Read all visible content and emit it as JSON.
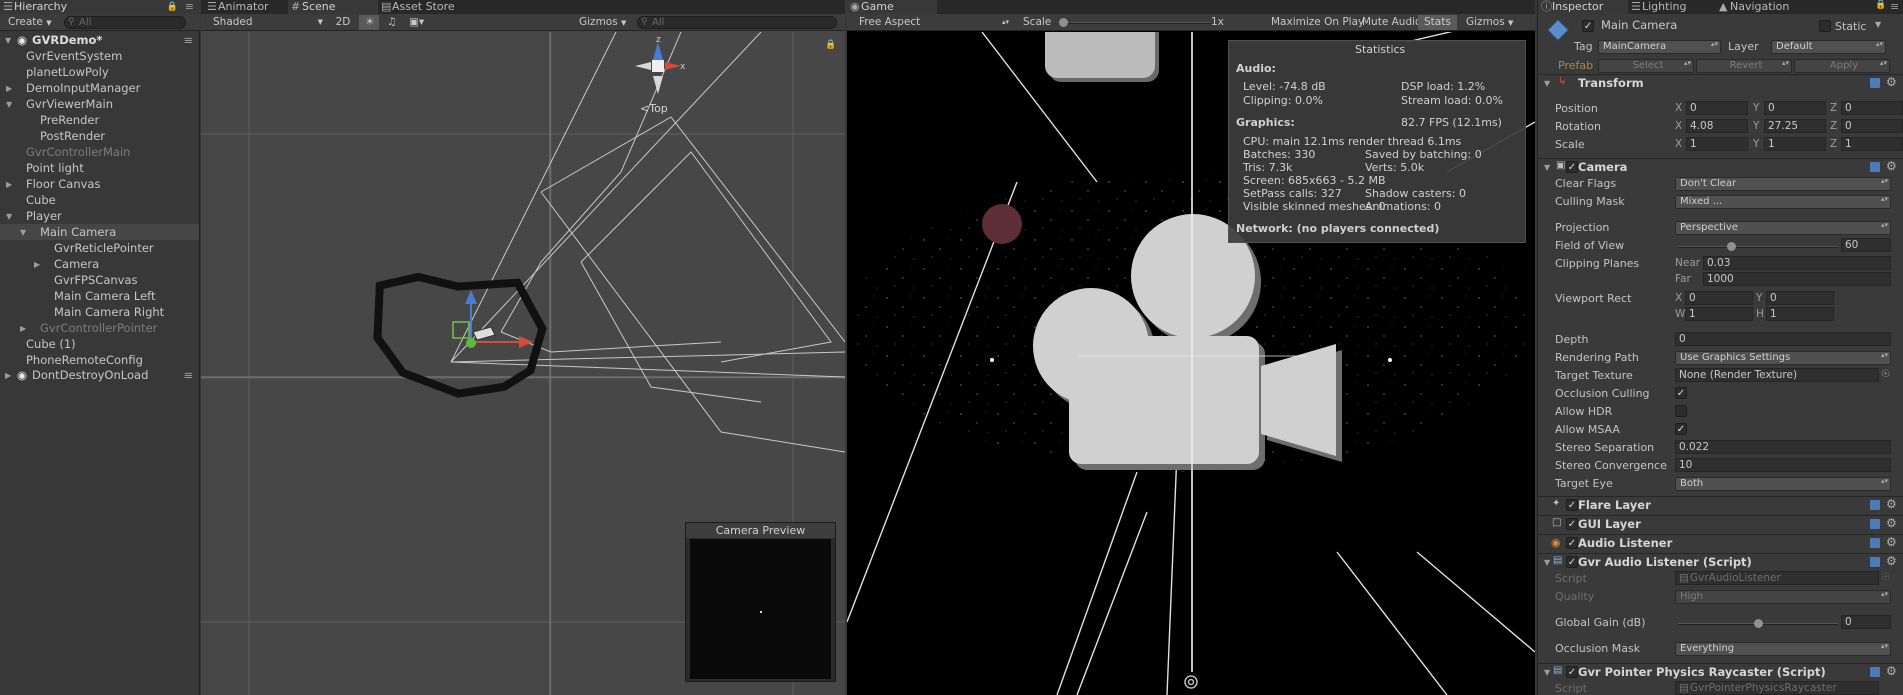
{
  "hierarchy": {
    "tab_label": "Hierarchy",
    "create_label": "Create",
    "search_placeholder": "All",
    "scene_name": "GVRDemo*",
    "items": [
      {
        "label": "GvrEventSystem",
        "indent": 1,
        "arrow": "",
        "dim": false
      },
      {
        "label": "planetLowPoly",
        "indent": 1,
        "arrow": "",
        "dim": false
      },
      {
        "label": "DemoInputManager",
        "indent": 1,
        "arrow": "right",
        "dim": false
      },
      {
        "label": "GvrViewerMain",
        "indent": 1,
        "arrow": "down",
        "dim": false
      },
      {
        "label": "PreRender",
        "indent": 2,
        "arrow": "",
        "dim": false
      },
      {
        "label": "PostRender",
        "indent": 2,
        "arrow": "",
        "dim": false
      },
      {
        "label": "GvrControllerMain",
        "indent": 1,
        "arrow": "",
        "dim": true
      },
      {
        "label": "Point light",
        "indent": 1,
        "arrow": "",
        "dim": false
      },
      {
        "label": "Floor Canvas",
        "indent": 1,
        "arrow": "right",
        "dim": false
      },
      {
        "label": "Cube",
        "indent": 1,
        "arrow": "",
        "dim": false
      },
      {
        "label": "Player",
        "indent": 1,
        "arrow": "down",
        "dim": false
      },
      {
        "label": "Main Camera",
        "indent": 2,
        "arrow": "down",
        "dim": false,
        "selected": true
      },
      {
        "label": "GvrReticlePointer",
        "indent": 3,
        "arrow": "",
        "dim": false
      },
      {
        "label": "Camera",
        "indent": 3,
        "arrow": "right",
        "dim": false
      },
      {
        "label": "GvrFPSCanvas",
        "indent": 3,
        "arrow": "",
        "dim": false
      },
      {
        "label": "Main Camera Left",
        "indent": 3,
        "arrow": "",
        "dim": false
      },
      {
        "label": "Main Camera Right",
        "indent": 3,
        "arrow": "",
        "dim": false
      },
      {
        "label": "GvrControllerPointer",
        "indent": 2,
        "arrow": "right",
        "dim": true
      },
      {
        "label": "Cube (1)",
        "indent": 1,
        "arrow": "",
        "dim": false
      },
      {
        "label": "PhoneRemoteConfig",
        "indent": 1,
        "arrow": "",
        "dim": false
      }
    ],
    "dont_destroy": "DontDestroyOnLoad"
  },
  "scene": {
    "tabs": [
      "Animator",
      "Scene",
      "Asset Store"
    ],
    "shading": "Shaded",
    "mode_2d": "2D",
    "gizmos": "Gizmos",
    "search_placeholder": "All",
    "gizmo_view_label": "<Top",
    "camera_preview_title": "Camera Preview"
  },
  "game": {
    "tab_label": "Game",
    "aspect": "Free Aspect",
    "scale_label": "Scale",
    "scale_value": "1x",
    "maximize": "Maximize On Play",
    "mute": "Mute Audio",
    "stats": "Stats",
    "gizmos": "Gizmos",
    "statistics": {
      "title": "Statistics",
      "audio_header": "Audio:",
      "level": "Level: -74.8 dB",
      "dsp": "DSP load: 1.2%",
      "clipping": "Clipping: 0.0%",
      "stream": "Stream load: 0.0%",
      "graphics_header": "Graphics:",
      "fps": "82.7 FPS (12.1ms)",
      "cpu": "CPU: main 12.1ms  render thread 6.1ms",
      "batches": "Batches: 330",
      "saved": "Saved by batching: 0",
      "tris": "Tris: 7.3k",
      "verts": "Verts: 5.0k",
      "screen": "Screen: 685x663 - 5.2 MB",
      "setpass": "SetPass calls: 327",
      "shadow": "Shadow casters: 0",
      "skinned": "Visible skinned meshes: 0",
      "animations": "Animations: 0",
      "network": "Network: (no players connected)"
    }
  },
  "inspector": {
    "tabs": [
      "Inspector",
      "Lighting",
      "Navigation"
    ],
    "object_name": "Main Camera",
    "static_label": "Static",
    "tag_label": "Tag",
    "tag_value": "MainCamera",
    "layer_label": "Layer",
    "layer_value": "Default",
    "prefab_label": "Prefab",
    "prefab_select": "Select",
    "prefab_revert": "Revert",
    "prefab_apply": "Apply",
    "transform": {
      "title": "Transform",
      "position_label": "Position",
      "position": [
        "0",
        "0",
        "0"
      ],
      "rotation_label": "Rotation",
      "rotation": [
        "4.08",
        "27.25",
        "0"
      ],
      "scale_label": "Scale",
      "scale": [
        "1",
        "1",
        "1"
      ]
    },
    "camera": {
      "title": "Camera",
      "clear_flags_label": "Clear Flags",
      "clear_flags": "Don't Clear",
      "culling_mask_label": "Culling Mask",
      "culling_mask": "Mixed ...",
      "projection_label": "Projection",
      "projection": "Perspective",
      "fov_label": "Field of View",
      "fov": "60",
      "fov_fraction": 0.33,
      "clipping_label": "Clipping Planes",
      "near_label": "Near",
      "near": "0.03",
      "far_label": "Far",
      "far": "1000",
      "viewport_label": "Viewport Rect",
      "vx": "0",
      "vy": "0",
      "vw": "1",
      "vh": "1",
      "depth_label": "Depth",
      "depth": "0",
      "rendering_path_label": "Rendering Path",
      "rendering_path": "Use Graphics Settings",
      "target_texture_label": "Target Texture",
      "target_texture": "None (Render Texture)",
      "occlusion_label": "Occlusion Culling",
      "hdr_label": "Allow HDR",
      "msaa_label": "Allow MSAA",
      "stereo_sep_label": "Stereo Separation",
      "stereo_sep": "0.022",
      "stereo_conv_label": "Stereo Convergence",
      "stereo_conv": "10",
      "target_eye_label": "Target Eye",
      "target_eye": "Both"
    },
    "flare_layer": "Flare Layer",
    "gui_layer": "GUI Layer",
    "audio_listener": "Audio Listener",
    "gvr_audio": {
      "title": "Gvr Audio Listener (Script)",
      "script_label": "Script",
      "script": "GvrAudioListener",
      "quality_label": "Quality",
      "quality": "High",
      "gain_label": "Global Gain (dB)",
      "gain": "0",
      "gain_fraction": 0.5,
      "occlusion_mask_label": "Occlusion Mask",
      "occlusion_mask": "Everything"
    },
    "raycaster": {
      "title": "Gvr Pointer Physics Raycaster (Script)",
      "script_label": "Script",
      "script": "GvrPointerPhysicsRaycaster"
    }
  }
}
